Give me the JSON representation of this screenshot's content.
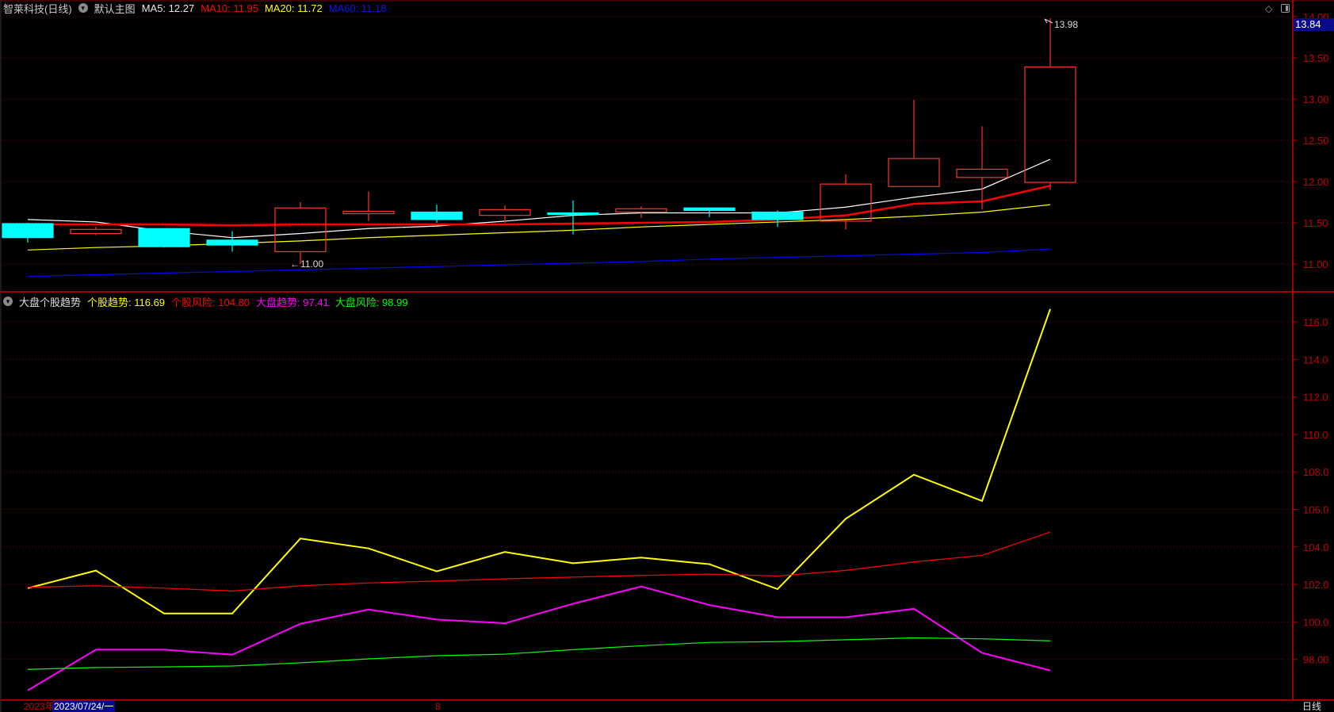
{
  "header": {
    "stock_title": "智莱科技(日线)",
    "main_chart_label": "默认主图",
    "ma5": "MA5: 12.27",
    "ma10": "MA10: 11.95",
    "ma20": "MA20: 11.72",
    "ma60": "MA60: 11.18"
  },
  "indicator_header": {
    "name": "大盘个股趋势",
    "s1": "个股趋势: 116.69",
    "s2": "个股风险: 104.80",
    "s3": "大盘趋势: 97.41",
    "s4": "大盘风险: 98.99"
  },
  "last_price": "13.84",
  "date_bar": {
    "year": "2023年",
    "cursor_date": "2023/07/24/一",
    "month_mark": "8",
    "period": "日线"
  },
  "colors": {
    "up": "#ff3232",
    "down": "#00ffff",
    "ma5": "#ffffff",
    "ma10": "#ff0000",
    "ma20": "#ffff00",
    "ma60": "#0000ff",
    "grid": "#7a0000",
    "axis": "#a00000"
  },
  "icons": [
    "chevron-down-icon",
    "diamond-icon",
    "panel-toggle-icon"
  ],
  "chart_data": [
    {
      "type": "candlestick",
      "title": "智莱科技(日线)",
      "ylim": [
        10.8,
        14.0
      ],
      "yticks": [
        "14.00",
        "13.50",
        "13.00",
        "12.50",
        "12.00",
        "11.50",
        "11.00"
      ],
      "ytick_values": [
        14.0,
        13.5,
        13.0,
        12.5,
        12.0,
        11.5,
        11.0
      ],
      "annotations": {
        "low": "11.00",
        "high": "13.98"
      },
      "candles": [
        {
          "o": 11.49,
          "h": 11.5,
          "l": 11.26,
          "c": 11.32
        },
        {
          "o": 11.37,
          "h": 11.45,
          "l": 11.35,
          "c": 11.42
        },
        {
          "o": 11.43,
          "h": 11.43,
          "l": 11.2,
          "c": 11.21
        },
        {
          "o": 11.29,
          "h": 11.4,
          "l": 11.15,
          "c": 11.23
        },
        {
          "o": 11.15,
          "h": 11.75,
          "l": 11.0,
          "c": 11.68
        },
        {
          "o": 11.61,
          "h": 11.88,
          "l": 11.52,
          "c": 11.64
        },
        {
          "o": 11.63,
          "h": 11.72,
          "l": 11.5,
          "c": 11.54
        },
        {
          "o": 11.59,
          "h": 11.71,
          "l": 11.5,
          "c": 11.66
        },
        {
          "o": 11.62,
          "h": 11.77,
          "l": 11.36,
          "c": 11.61
        },
        {
          "o": 11.63,
          "h": 11.7,
          "l": 11.56,
          "c": 11.67
        },
        {
          "o": 11.68,
          "h": 11.68,
          "l": 11.57,
          "c": 11.65
        },
        {
          "o": 11.63,
          "h": 11.65,
          "l": 11.45,
          "c": 11.54
        },
        {
          "o": 11.52,
          "h": 12.09,
          "l": 11.42,
          "c": 11.97
        },
        {
          "o": 11.94,
          "h": 12.99,
          "l": 11.94,
          "c": 12.28
        },
        {
          "o": 12.05,
          "h": 12.67,
          "l": 11.66,
          "c": 12.15
        },
        {
          "o": 11.99,
          "h": 13.98,
          "l": 11.9,
          "c": 13.39
        }
      ],
      "series": [
        {
          "name": "MA5",
          "color_key": "ma5",
          "values": [
            11.54,
            11.51,
            11.4,
            11.32,
            11.37,
            11.43,
            11.46,
            11.52,
            11.59,
            11.62,
            11.62,
            11.62,
            11.69,
            11.81,
            11.91,
            12.27
          ]
        },
        {
          "name": "MA10",
          "color_key": "ma10",
          "values": [
            11.48,
            11.48,
            11.48,
            11.47,
            11.48,
            11.48,
            11.48,
            11.48,
            11.49,
            11.5,
            11.51,
            11.54,
            11.59,
            11.73,
            11.76,
            11.95
          ]
        },
        {
          "name": "MA20",
          "color_key": "ma20",
          "values": [
            11.17,
            11.2,
            11.22,
            11.25,
            11.28,
            11.32,
            11.35,
            11.38,
            11.41,
            11.45,
            11.48,
            11.51,
            11.54,
            11.58,
            11.63,
            11.72
          ]
        },
        {
          "name": "MA60",
          "color_key": "ma60",
          "values": [
            10.85,
            10.87,
            10.89,
            10.91,
            10.93,
            10.95,
            10.97,
            10.99,
            11.01,
            11.03,
            11.06,
            11.08,
            11.1,
            11.12,
            11.14,
            11.18
          ]
        }
      ]
    },
    {
      "type": "line",
      "title": "大盘个股趋势",
      "ylim": [
        96.0,
        117.5
      ],
      "yticks": [
        "116.0",
        "114.0",
        "112.0",
        "110.0",
        "108.0",
        "106.0",
        "104.0",
        "102.0",
        "100.0",
        "98.00"
      ],
      "ytick_values": [
        116,
        114,
        112,
        110,
        108,
        106,
        104,
        102,
        100,
        98
      ],
      "series": [
        {
          "name": "个股趋势",
          "color": "#ffff00",
          "values": [
            101.8,
            102.74,
            100.45,
            100.45,
            104.45,
            103.92,
            102.7,
            103.73,
            103.13,
            103.43,
            103.08,
            101.75,
            105.5,
            107.85,
            106.45,
            116.69
          ]
        },
        {
          "name": "个股风险",
          "color": "#ff0000",
          "values": [
            101.85,
            101.93,
            101.8,
            101.65,
            101.93,
            102.08,
            102.18,
            102.3,
            102.39,
            102.48,
            102.55,
            102.45,
            102.75,
            103.2,
            103.55,
            104.8
          ]
        },
        {
          "name": "大盘趋势",
          "color": "#ff00ff",
          "values": [
            96.35,
            98.52,
            98.52,
            98.25,
            99.9,
            100.66,
            100.13,
            99.93,
            100.97,
            101.89,
            100.9,
            100.25,
            100.25,
            100.7,
            98.35,
            97.41
          ]
        },
        {
          "name": "大盘风险",
          "color": "#00ff00",
          "values": [
            97.47,
            97.57,
            97.6,
            97.65,
            97.82,
            98.03,
            98.2,
            98.28,
            98.52,
            98.73,
            98.91,
            98.95,
            99.05,
            99.15,
            99.1,
            98.99
          ]
        }
      ]
    }
  ]
}
